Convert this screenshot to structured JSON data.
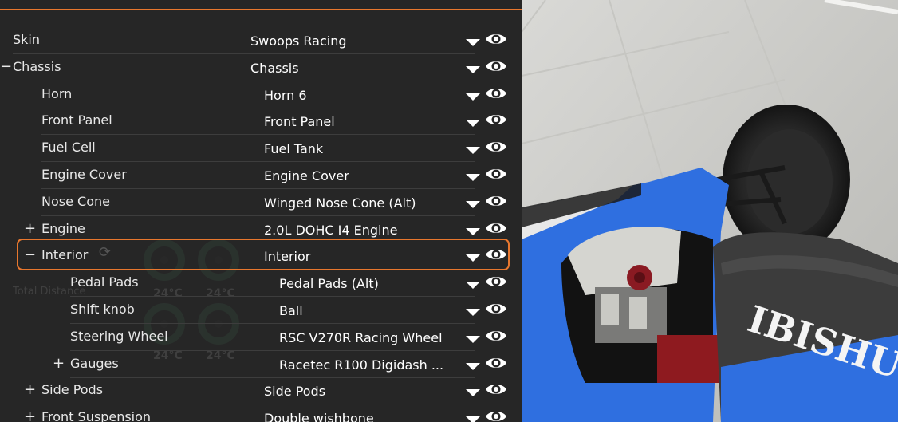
{
  "parts": [
    {
      "label": "Skin",
      "value": "Swoops Racing",
      "toggle": "",
      "depth": 0
    },
    {
      "label": "Chassis",
      "value": "Chassis",
      "toggle": "−",
      "depth": 0
    },
    {
      "label": "Horn",
      "value": "Horn 6",
      "toggle": "",
      "depth": 1
    },
    {
      "label": "Front Panel",
      "value": "Front Panel",
      "toggle": "",
      "depth": 1
    },
    {
      "label": "Fuel Cell",
      "value": "Fuel Tank",
      "toggle": "",
      "depth": 1
    },
    {
      "label": "Engine Cover",
      "value": "Engine Cover",
      "toggle": "",
      "depth": 1
    },
    {
      "label": "Nose Cone",
      "value": "Winged Nose Cone (Alt)",
      "toggle": "",
      "depth": 1
    },
    {
      "label": "Engine",
      "value": "2.0L DOHC I4 Engine",
      "toggle": "+",
      "depth": 1
    },
    {
      "label": "Interior",
      "value": "Interior",
      "toggle": "−",
      "depth": 1,
      "selected": true
    },
    {
      "label": "Pedal Pads",
      "value": "Pedal Pads (Alt)",
      "toggle": "",
      "depth": 2
    },
    {
      "label": "Shift knob",
      "value": "Ball",
      "toggle": "",
      "depth": 2
    },
    {
      "label": "Steering Wheel",
      "value": "RSC V270R Racing Wheel",
      "toggle": "",
      "depth": 2
    },
    {
      "label": "Gauges",
      "value": "Racetec R100 Digidash ...",
      "toggle": "+",
      "depth": 2
    },
    {
      "label": "Side Pods",
      "value": "Side Pods",
      "toggle": "+",
      "depth": 1
    },
    {
      "label": "Front Suspension",
      "value": "Double wishbone",
      "toggle": "+",
      "depth": 1
    }
  ],
  "hud_background": {
    "distance_label": "Total Distance",
    "temps": [
      "24°C",
      "24°C",
      "24°C",
      "24°C"
    ]
  },
  "viewport": {
    "car_brand_text": "IBISHU",
    "body_color": "#2f6fe0",
    "accent_color": "#e8772e"
  }
}
